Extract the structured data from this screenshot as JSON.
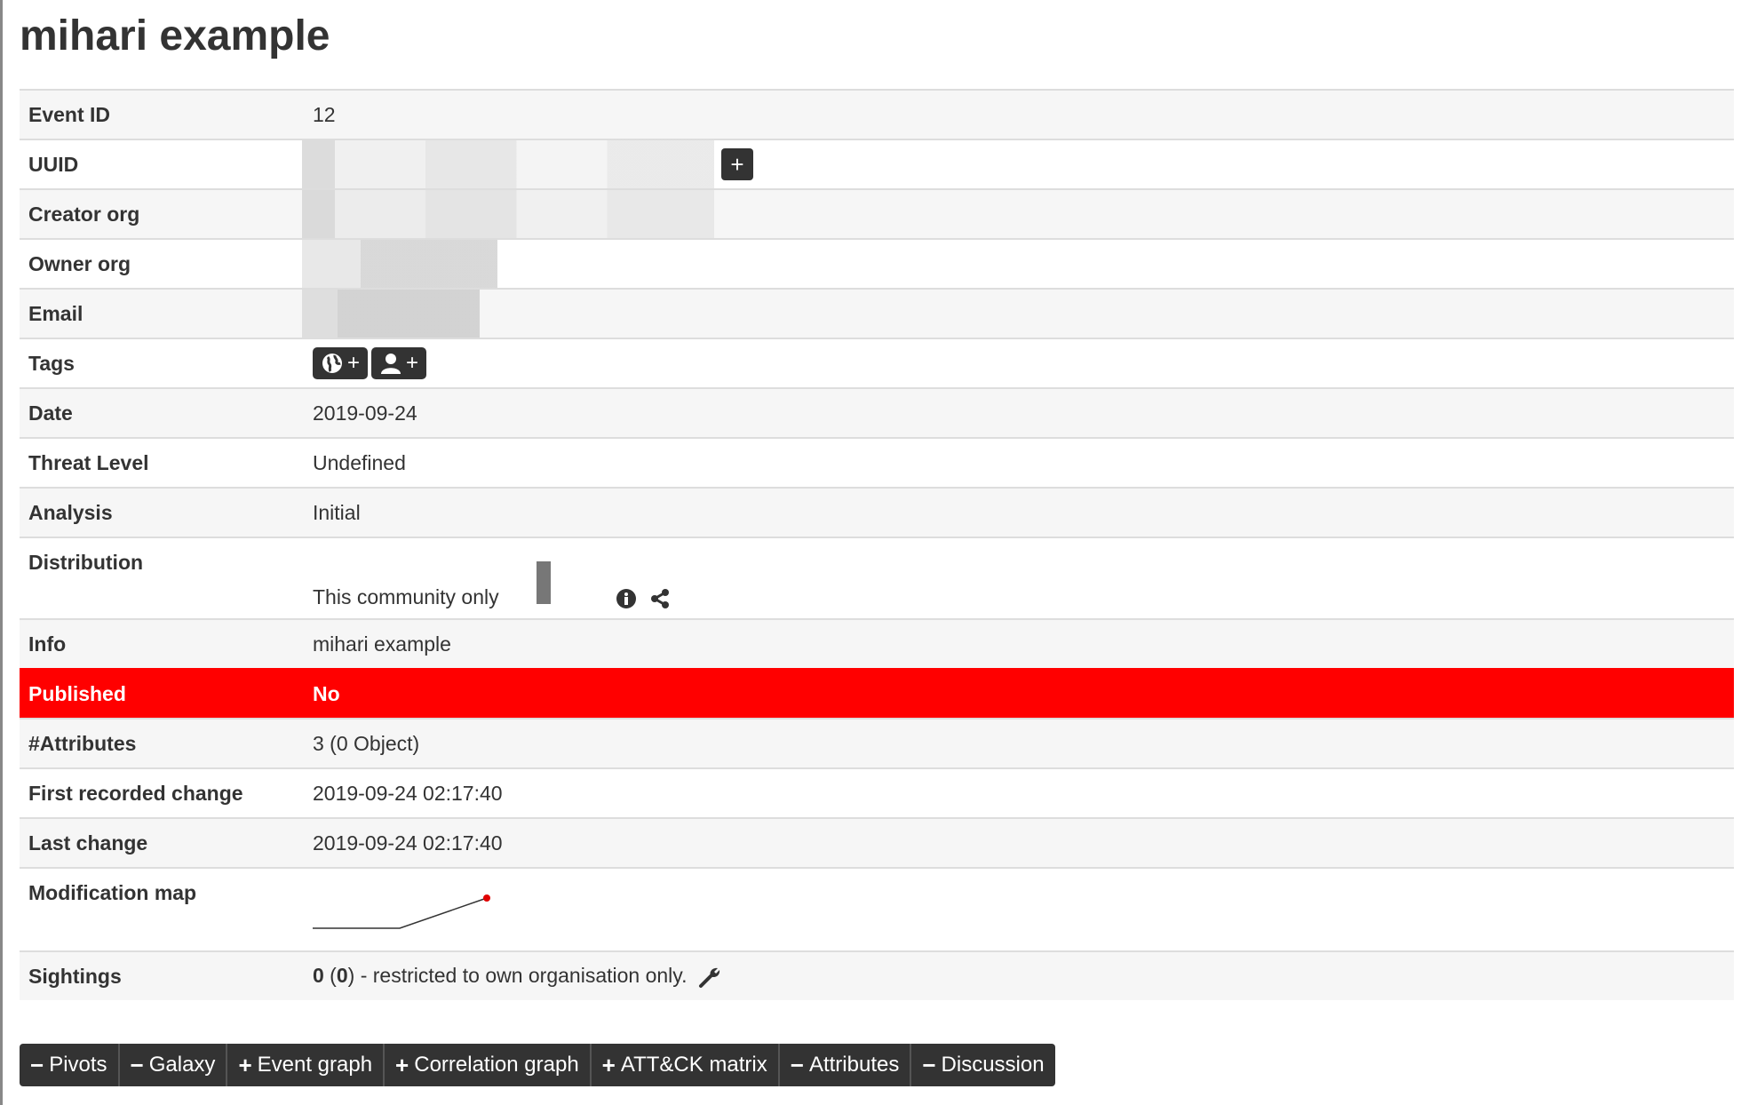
{
  "page": {
    "title": "mihari example"
  },
  "rows": {
    "event_id": {
      "label": "Event ID",
      "value": "12"
    },
    "uuid": {
      "label": "UUID",
      "add_label": "+"
    },
    "creator_org": {
      "label": "Creator org"
    },
    "owner_org": {
      "label": "Owner org"
    },
    "email": {
      "label": "Email"
    },
    "tags": {
      "label": "Tags",
      "plus": "+"
    },
    "date": {
      "label": "Date",
      "value": "2019-09-24"
    },
    "threat_level": {
      "label": "Threat Level",
      "value": "Undefined"
    },
    "analysis": {
      "label": "Analysis",
      "value": "Initial"
    },
    "distribution": {
      "label": "Distribution",
      "value": "This community only"
    },
    "info": {
      "label": "Info",
      "value": "mihari example"
    },
    "published": {
      "label": "Published",
      "value": "No"
    },
    "attributes": {
      "label": "#Attributes",
      "value": "3 (0 Object)"
    },
    "first_change": {
      "label": "First recorded change",
      "value": "2019-09-24 02:17:40"
    },
    "last_change": {
      "label": "Last change",
      "value": "2019-09-24 02:17:40"
    },
    "modification_map": {
      "label": "Modification map"
    },
    "sightings": {
      "label": "Sightings",
      "count": "0",
      "count_paren": "0",
      "suffix": " - restricted to own organisation only."
    }
  },
  "tabs": [
    {
      "sign": "−",
      "label": "Pivots"
    },
    {
      "sign": "−",
      "label": "Galaxy"
    },
    {
      "sign": "+",
      "label": "Event graph"
    },
    {
      "sign": "+",
      "label": "Correlation graph"
    },
    {
      "sign": "+",
      "label": "ATT&CK matrix"
    },
    {
      "sign": "−",
      "label": "Attributes"
    },
    {
      "sign": "−",
      "label": "Discussion"
    }
  ],
  "colors": {
    "published_bg": "#ff0000",
    "dark": "#333333",
    "map_point": "#e00000"
  }
}
